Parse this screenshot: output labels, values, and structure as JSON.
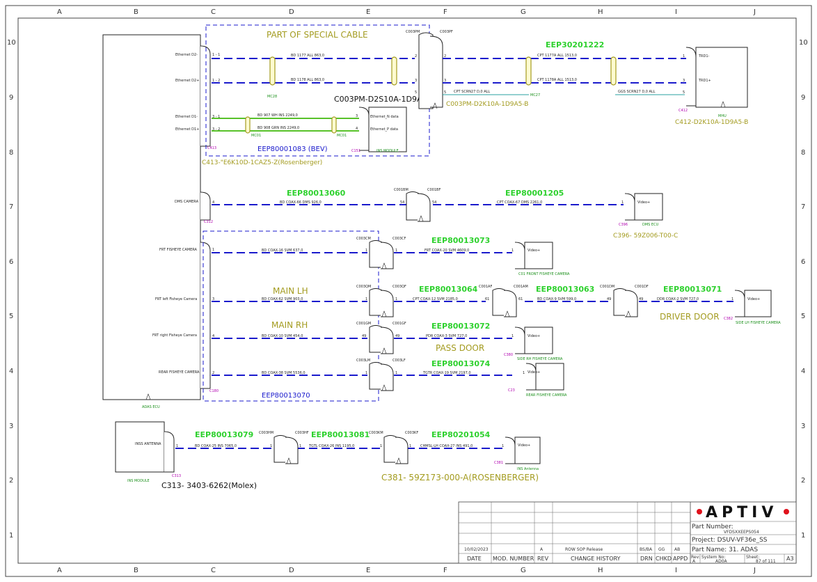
{
  "grid": {
    "columns": [
      "A",
      "B",
      "C",
      "D",
      "E",
      "F",
      "G",
      "H",
      "I",
      "J"
    ],
    "rows": [
      "10",
      "9",
      "8",
      "7",
      "6",
      "5",
      "4",
      "3",
      "2",
      "1"
    ]
  },
  "annotations": {
    "special_cable": "PART OF SPECIAL CABLE",
    "main_lh": "MAIN LH",
    "main_rh": "MAIN RH",
    "pass_door": "PASS DOOR",
    "driver_door": "DRIVER DOOR",
    "eep80001083": "EEP80001083 (BEV)",
    "eep80013070": "EEP80013070",
    "c003pm_d2s10a": "C003PM-D2S10A-1D9A5-B",
    "c003pm_d2k10a": "C003PM-D2K10A-1D9A5-B",
    "c412_d2k10a": "C412-D2K10A-1D9A5-B",
    "c413_e6k10d": "C413-\"E6K10D-1CAZ5-Z(Rosenberger)",
    "c396_59z006": "C396- 59Z006-T00-C",
    "c313_3403": "C313- 3403-6262(Molex)",
    "c381_59z173": "C381- 59Z173-000-A(ROSENBERGER)"
  },
  "eep_labels": {
    "e30201222": "EEP30201222",
    "e80013060": "EEP80013060",
    "e80001205": "EEP80001205",
    "e80013073": "EEP80013073",
    "e80013064": "EEP80013064",
    "e80013063": "EEP80013063",
    "e80013071": "EEP80013071",
    "e80013072": "EEP80013072",
    "e80013074": "EEP80013074",
    "e80013079": "EEP80013079",
    "e80013081": "EEP80013081",
    "e80201054": "EEP80201054"
  },
  "ecu": {
    "name": "ADAS ECU",
    "connector_top": "C413",
    "connector_dms": "C312",
    "connector_cam": "C180",
    "pins": {
      "eth_d2m": "Ethernet D2-",
      "eth_d2p": "Ethernet D2+",
      "eth_d1m": "Ethernet D1-",
      "eth_d1p": "Ethernet D1+",
      "dms": "DMS CAMERA",
      "frt_fisheye": "FRT FISHEYE CAMERA",
      "frt_left": "FRT left Fisheye Camera",
      "frt_right": "FRT right Fisheye Camera",
      "rear_fisheye": "REAR FISHEYE CAMERA"
    }
  },
  "connectors": {
    "c003pm": "C003PM",
    "c003pf": "C003PF",
    "c001bm": "C001BM",
    "c001bf": "C001BF",
    "c003cm": "C003CM",
    "c003cf": "C003CF",
    "c003qm": "C003QM",
    "c003qf": "C003QF",
    "c001af": "C001AF",
    "c001am": "C001AM",
    "c001dm": "C001DM",
    "c001df": "C001DF",
    "c001gm": "C001GM",
    "c001gf": "C001GF",
    "c003lm": "C003LM",
    "c003lf": "C003LF",
    "c003hm": "C003HM",
    "c003hf": "C003HF",
    "c003km": "C003KM",
    "c003kf": "C003KF"
  },
  "ferrites": {
    "mc28": "MC28",
    "mc27": "MC27",
    "mc01a": "MC01",
    "mc01b": "MC01"
  },
  "wires": {
    "w_bd1177": "BD  1177    ALL  863,0",
    "w_bd1178": "BD  1178    ALL  863,0",
    "w_cpt1177a": "CPT  1177A    ALL  1513,0",
    "w_cpt1178a": "CPT  1178A    ALL  1513,0",
    "w_cpt_scrn27": "CPT  SCRN27    D,0  ALL",
    "w_ggs_scrn27": "GGS  SCRN27    D,0  ALL",
    "w_bd907": "BD  907  WH    INS  2249,0",
    "w_bd908": "BD  908  GRN    INS  2249,0",
    "w_bd_coax66": "BD  COAX-66    DMS  926,0",
    "w_cpt_coax67": "CPT  COAX-67    DMS  2261,0",
    "w_bd_coax16": "BD  COAX-16    SVM  637,0",
    "w_frt_coax20": "FRT  COAX-20    SVM  4609,0",
    "w_bd_coax62": "BD  COAX-62    SVM  903,0",
    "w_cpt_coax12": "CPT  COAX-12    SVM  2185,0",
    "w_bd_coax9": "BD  COAX-9    SVM  599,0",
    "w_ddr_coax2": "DDR  COAX-2    SVM  727,0",
    "w_bd_coax10": "BD  COAX-10    SVM  454,0",
    "w_pdr_coax3": "PDR  COAX-3    SVM  727,0",
    "w_bd_coax38": "BD  COAX-38    SVM  5536,0",
    "w_tgtr_coax19": "TGTR  COAX-19    SVM  2197,0",
    "w_bd_coax25": "BD  COAX-25    INS  7065,0",
    "w_tgtl_coax26": "TGTL  COAX-26    INS  1195,0",
    "w_chmsl_coax27": "CHMSL-LH  COAX-27    INS  491,0"
  },
  "devices": {
    "mhu": "MHU",
    "c412": "C412",
    "trd1m": "TRD1-",
    "trd1p": "TRD1+",
    "ins_module": "INS MODULE",
    "c151": "C151",
    "eth_n": "Ethernet_N data",
    "eth_p": "Ethernet_P data",
    "dms_ecu": "DMS ECU",
    "c396": "C396",
    "video": "Video+",
    "c01_front": "C01 FRONT FISHEYE CAMERA",
    "c382": "C382",
    "side_lh": "SIDE LH FISHEYE CAMERA",
    "c380": "C380",
    "side_rh": "SIDE RH FISHEYE CAMERA",
    "c23": "C23",
    "rear_cam": "REAR FISHEYE CAMERA",
    "inss_antenna": "INSS ANTENNA",
    "ins_module2": "INS MODULE",
    "c313": "C313",
    "c381": "C381",
    "ins_antenna": "INS Antenna"
  },
  "title_block": {
    "logo": "APTIV",
    "part_number_label": "Part Number:",
    "part_number": "VFDSXXEEPS054",
    "project": "Project: DSUV-VF36e_SS",
    "part_name": "Part Name:  31. ADAS",
    "date_val": "10/02/2023",
    "rev_val": "A",
    "change_val": "ROW SOP Release",
    "drn_val": "BS/BA",
    "chkd_val": "GG",
    "appd_val": "AB",
    "h_date": "DATE",
    "h_mod": "MOD. NUMBER",
    "h_rev": "REV",
    "h_change": "CHANGE HISTORY",
    "h_drn": "DRN",
    "h_chkd": "CHKD",
    "h_appd": "APPD",
    "rev_label": "Rev:",
    "rev_code": "A",
    "system_no_label": "System No:",
    "system_no": "AD0A",
    "sheet_label": "Sheet:",
    "sheet": "87  of 111",
    "size": "A3"
  }
}
